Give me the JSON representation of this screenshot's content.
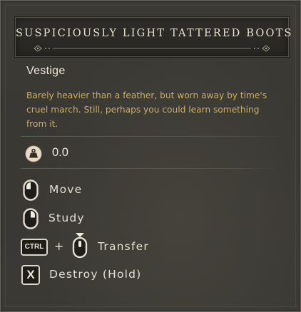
{
  "tooltip": {
    "item_name": "SUSPICIOUSLY LIGHT TATTERED BOOTS",
    "item_type": "Vestige",
    "description": "Barely heavier than a feather, but worn away by time's cruel march. Still, perhaps you could learn something from it.",
    "weight": {
      "icon": "weight-icon",
      "value": "0.0"
    },
    "actions": [
      {
        "key_icon": "mouse-left-click-icon",
        "label": "Move"
      },
      {
        "key_icon": "mouse-right-click-icon",
        "label": "Study"
      },
      {
        "key_label": "CTRL",
        "plus": "+",
        "key_icon": "mouse-middle-click-icon",
        "label": "Transfer"
      },
      {
        "key_label": "X",
        "label": "Destroy (Hold)"
      }
    ]
  },
  "colors": {
    "background": "#3a3833",
    "title_text": "#e9e2d1",
    "description_text": "#cfae55",
    "primary_text": "#ece6d8"
  }
}
